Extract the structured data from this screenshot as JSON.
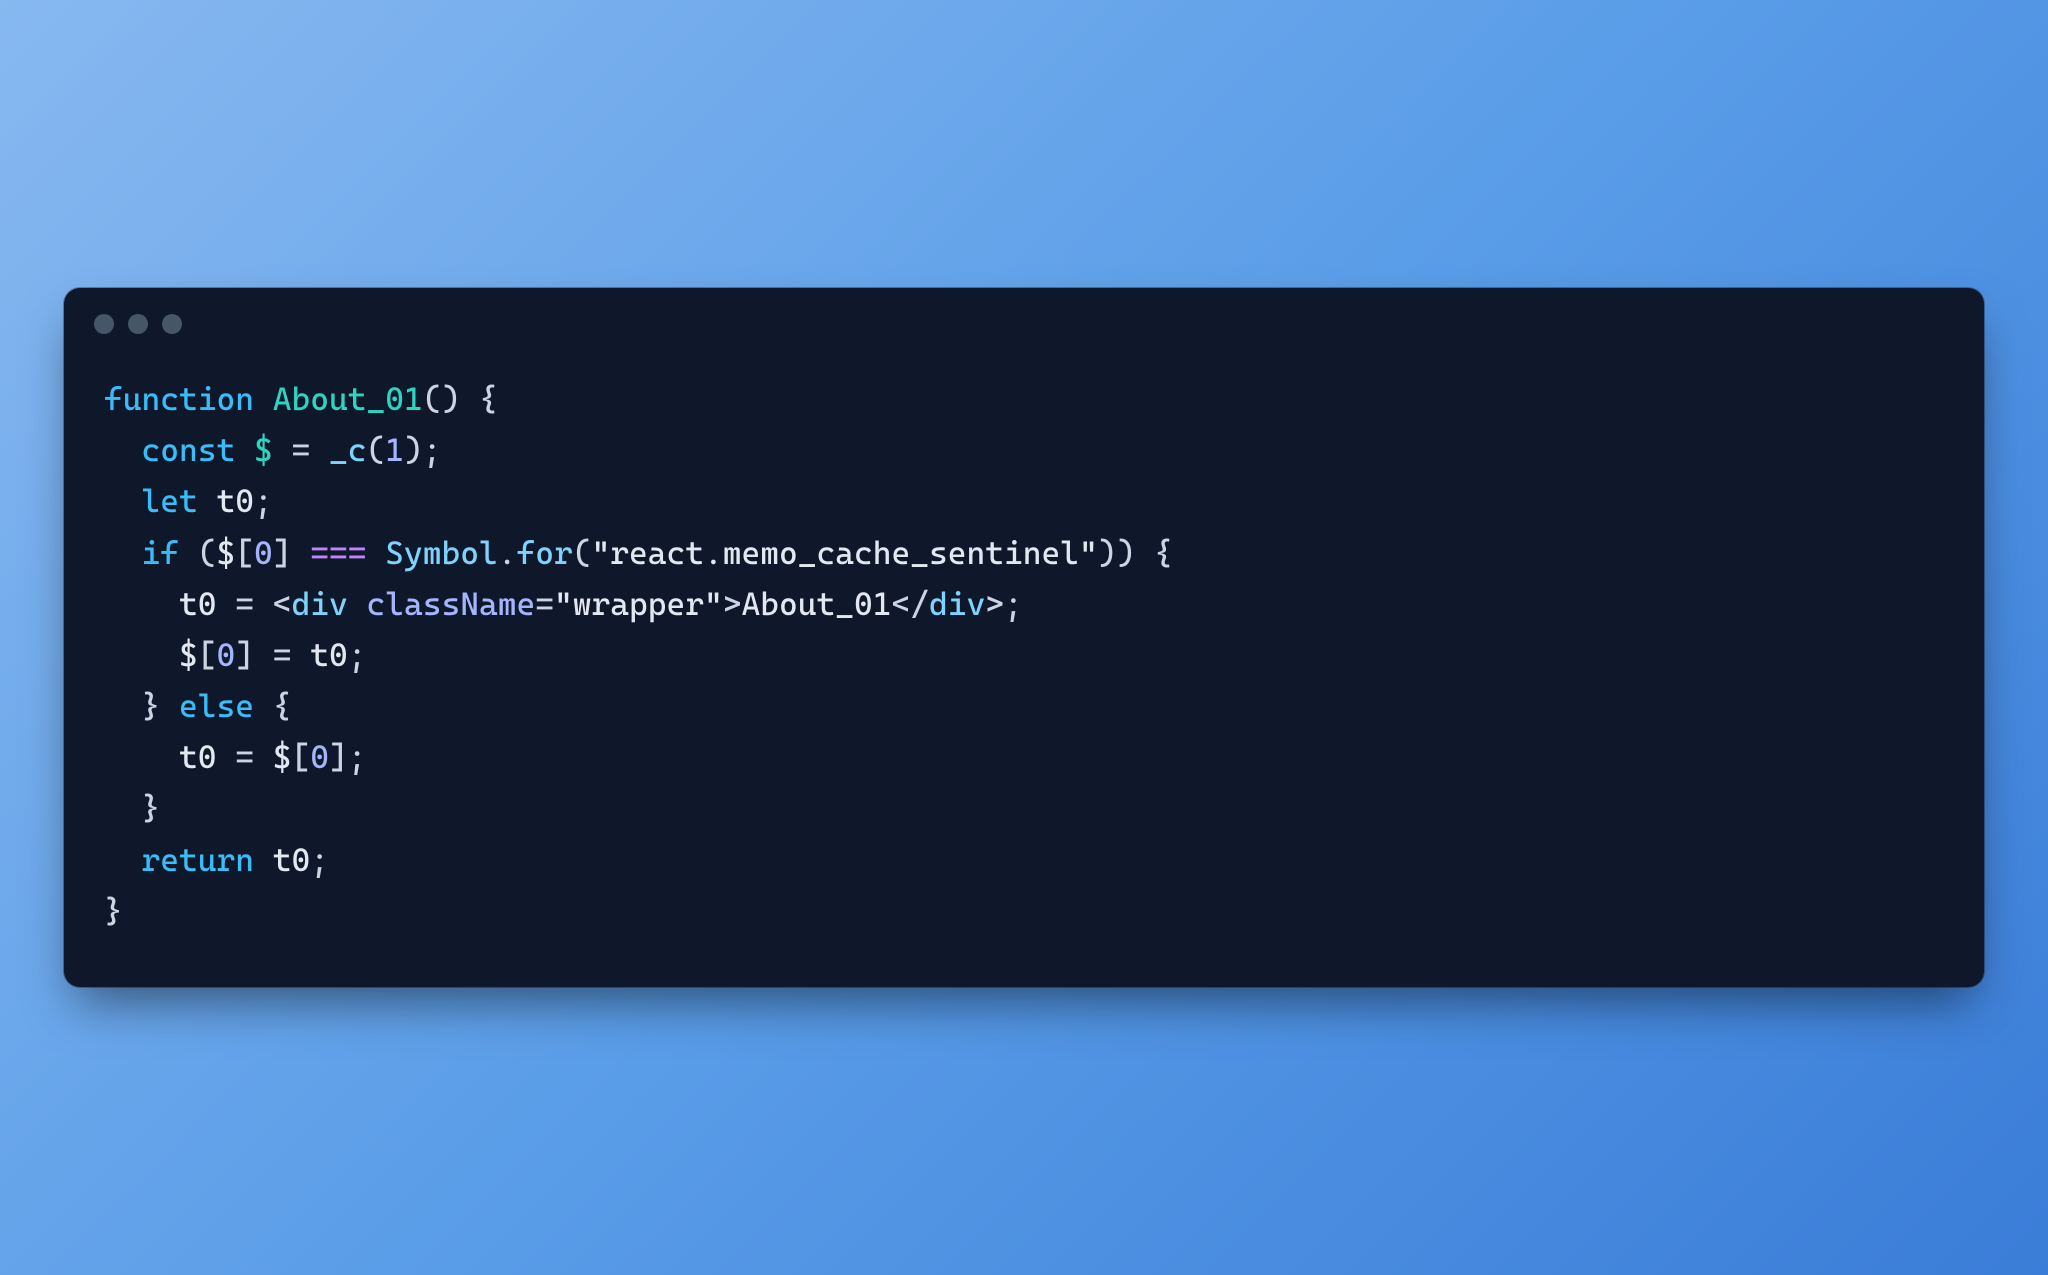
{
  "code": {
    "lines": [
      {
        "indent": 0,
        "tokens": [
          {
            "t": "function",
            "c": "keyword"
          },
          {
            "t": " ",
            "c": "punct"
          },
          {
            "t": "About_01",
            "c": "fn"
          },
          {
            "t": "()",
            "c": "punct"
          },
          {
            "t": " {",
            "c": "punct"
          }
        ]
      },
      {
        "indent": 1,
        "tokens": [
          {
            "t": "const",
            "c": "keyword"
          },
          {
            "t": " ",
            "c": "punct"
          },
          {
            "t": "$",
            "c": "dollar"
          },
          {
            "t": " ",
            "c": "punct"
          },
          {
            "t": "=",
            "c": "eq"
          },
          {
            "t": " ",
            "c": "punct"
          },
          {
            "t": "_c",
            "c": "call"
          },
          {
            "t": "(",
            "c": "punct"
          },
          {
            "t": "1",
            "c": "num"
          },
          {
            "t": ");",
            "c": "punct"
          }
        ]
      },
      {
        "indent": 1,
        "tokens": [
          {
            "t": "let",
            "c": "keyword"
          },
          {
            "t": " ",
            "c": "punct"
          },
          {
            "t": "t0",
            "c": "var"
          },
          {
            "t": ";",
            "c": "punct"
          }
        ]
      },
      {
        "indent": 1,
        "tokens": [
          {
            "t": "if",
            "c": "keyword"
          },
          {
            "t": " (",
            "c": "punct"
          },
          {
            "t": "$",
            "c": "var"
          },
          {
            "t": "[",
            "c": "punct"
          },
          {
            "t": "0",
            "c": "num"
          },
          {
            "t": "] ",
            "c": "punct"
          },
          {
            "t": "===",
            "c": "op"
          },
          {
            "t": " ",
            "c": "punct"
          },
          {
            "t": "Symbol",
            "c": "call"
          },
          {
            "t": ".",
            "c": "punct"
          },
          {
            "t": "for",
            "c": "call"
          },
          {
            "t": "(",
            "c": "punct"
          },
          {
            "t": "\"react.memo_cache_sentinel\"",
            "c": "str"
          },
          {
            "t": ")) {",
            "c": "punct"
          }
        ]
      },
      {
        "indent": 2,
        "tokens": [
          {
            "t": "t0",
            "c": "var"
          },
          {
            "t": " ",
            "c": "punct"
          },
          {
            "t": "=",
            "c": "eq"
          },
          {
            "t": " ",
            "c": "punct"
          },
          {
            "t": "<",
            "c": "angle"
          },
          {
            "t": "div",
            "c": "tag"
          },
          {
            "t": " ",
            "c": "punct"
          },
          {
            "t": "className",
            "c": "attr"
          },
          {
            "t": "=",
            "c": "eq"
          },
          {
            "t": "\"wrapper\"",
            "c": "str"
          },
          {
            "t": ">",
            "c": "angle"
          },
          {
            "t": "About_01",
            "c": "var"
          },
          {
            "t": "</",
            "c": "angle"
          },
          {
            "t": "div",
            "c": "tag"
          },
          {
            "t": ">",
            "c": "angle"
          },
          {
            "t": ";",
            "c": "punct"
          }
        ]
      },
      {
        "indent": 2,
        "tokens": [
          {
            "t": "$",
            "c": "var"
          },
          {
            "t": "[",
            "c": "punct"
          },
          {
            "t": "0",
            "c": "num"
          },
          {
            "t": "] ",
            "c": "punct"
          },
          {
            "t": "=",
            "c": "eq"
          },
          {
            "t": " ",
            "c": "punct"
          },
          {
            "t": "t0",
            "c": "var"
          },
          {
            "t": ";",
            "c": "punct"
          }
        ]
      },
      {
        "indent": 1,
        "tokens": [
          {
            "t": "} ",
            "c": "punct"
          },
          {
            "t": "else",
            "c": "keyword"
          },
          {
            "t": " {",
            "c": "punct"
          }
        ]
      },
      {
        "indent": 2,
        "tokens": [
          {
            "t": "t0",
            "c": "var"
          },
          {
            "t": " ",
            "c": "punct"
          },
          {
            "t": "=",
            "c": "eq"
          },
          {
            "t": " ",
            "c": "punct"
          },
          {
            "t": "$",
            "c": "var"
          },
          {
            "t": "[",
            "c": "punct"
          },
          {
            "t": "0",
            "c": "num"
          },
          {
            "t": "];",
            "c": "punct"
          }
        ]
      },
      {
        "indent": 1,
        "tokens": [
          {
            "t": "}",
            "c": "punct"
          }
        ]
      },
      {
        "indent": 1,
        "tokens": [
          {
            "t": "return",
            "c": "keyword"
          },
          {
            "t": " ",
            "c": "punct"
          },
          {
            "t": "t0",
            "c": "var"
          },
          {
            "t": ";",
            "c": "punct"
          }
        ]
      },
      {
        "indent": 0,
        "tokens": [
          {
            "t": "}",
            "c": "punct"
          }
        ]
      }
    ]
  }
}
